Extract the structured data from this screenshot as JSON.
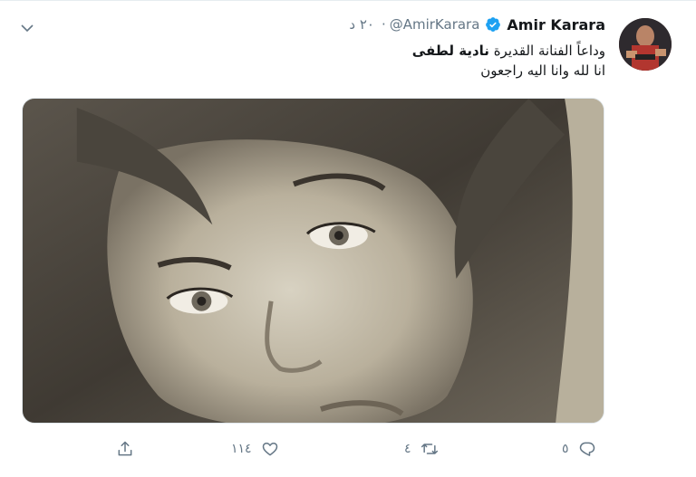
{
  "tweet": {
    "name": "Amir Karara",
    "handle": "@AmirKarara",
    "separator": "·",
    "time": "٢٠ د",
    "text_line1_before": "وداعاً الفنانة القديرة ",
    "text_line1_bold": "نادية لطفى",
    "text_line2": "انا لله وانا اليه راجعون",
    "reply_count": "٥",
    "retweet_count": "٤",
    "like_count": "١١٤"
  },
  "colors": {
    "verified": "#1da1f2",
    "secondary_text": "#657786",
    "text": "#14171a"
  },
  "icons": {
    "verified": "verified-badge-icon",
    "menu": "chevron-down-icon",
    "reply": "reply-icon",
    "retweet": "retweet-icon",
    "like": "heart-icon",
    "share": "share-icon"
  }
}
